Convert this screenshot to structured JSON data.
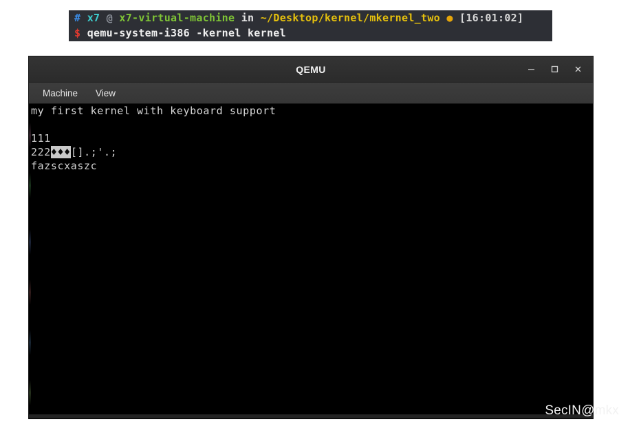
{
  "terminal": {
    "prompt_line": {
      "hash": "#",
      "user": "x7",
      "at": "@",
      "host": "x7-virtual-machine",
      "in": "in",
      "path": "~/Desktop/kernel/mkernel_two",
      "clock_glyph": "●",
      "time": "[16:01:02]"
    },
    "command_line": {
      "dollar": "$",
      "command": "qemu-system-i386 -kernel kernel"
    },
    "colors": {
      "background": "#2d2f35",
      "hash": "#3b8eea",
      "user": "#3ecfcf",
      "at": "#8a8f98",
      "host": "#7fc436",
      "in": "#e6e6e6",
      "path": "#e5c00d",
      "time": "#d6d6d6",
      "dollar": "#e4392f",
      "command": "#f0f0f0"
    }
  },
  "qemu_window": {
    "title": "QEMU",
    "controls": {
      "minimize": "minimize-icon",
      "maximize": "maximize-icon",
      "close": "close-icon"
    },
    "menubar": {
      "items": [
        {
          "label": "Machine",
          "name": "menu-item-machine"
        },
        {
          "label": "View",
          "name": "menu-item-view"
        }
      ]
    },
    "console": {
      "background": "#000000",
      "foreground": "#cfcfcf",
      "lines": [
        {
          "text": "my first kernel with keyboard support"
        },
        {
          "text": ""
        },
        {
          "text": "111"
        },
        {
          "prefix": "222",
          "inverse": "♦♦♦",
          "suffix": "[].;'.;"
        },
        {
          "text": "fazscxaszc"
        }
      ]
    }
  },
  "watermark": {
    "text": "SecIN@mkx"
  }
}
